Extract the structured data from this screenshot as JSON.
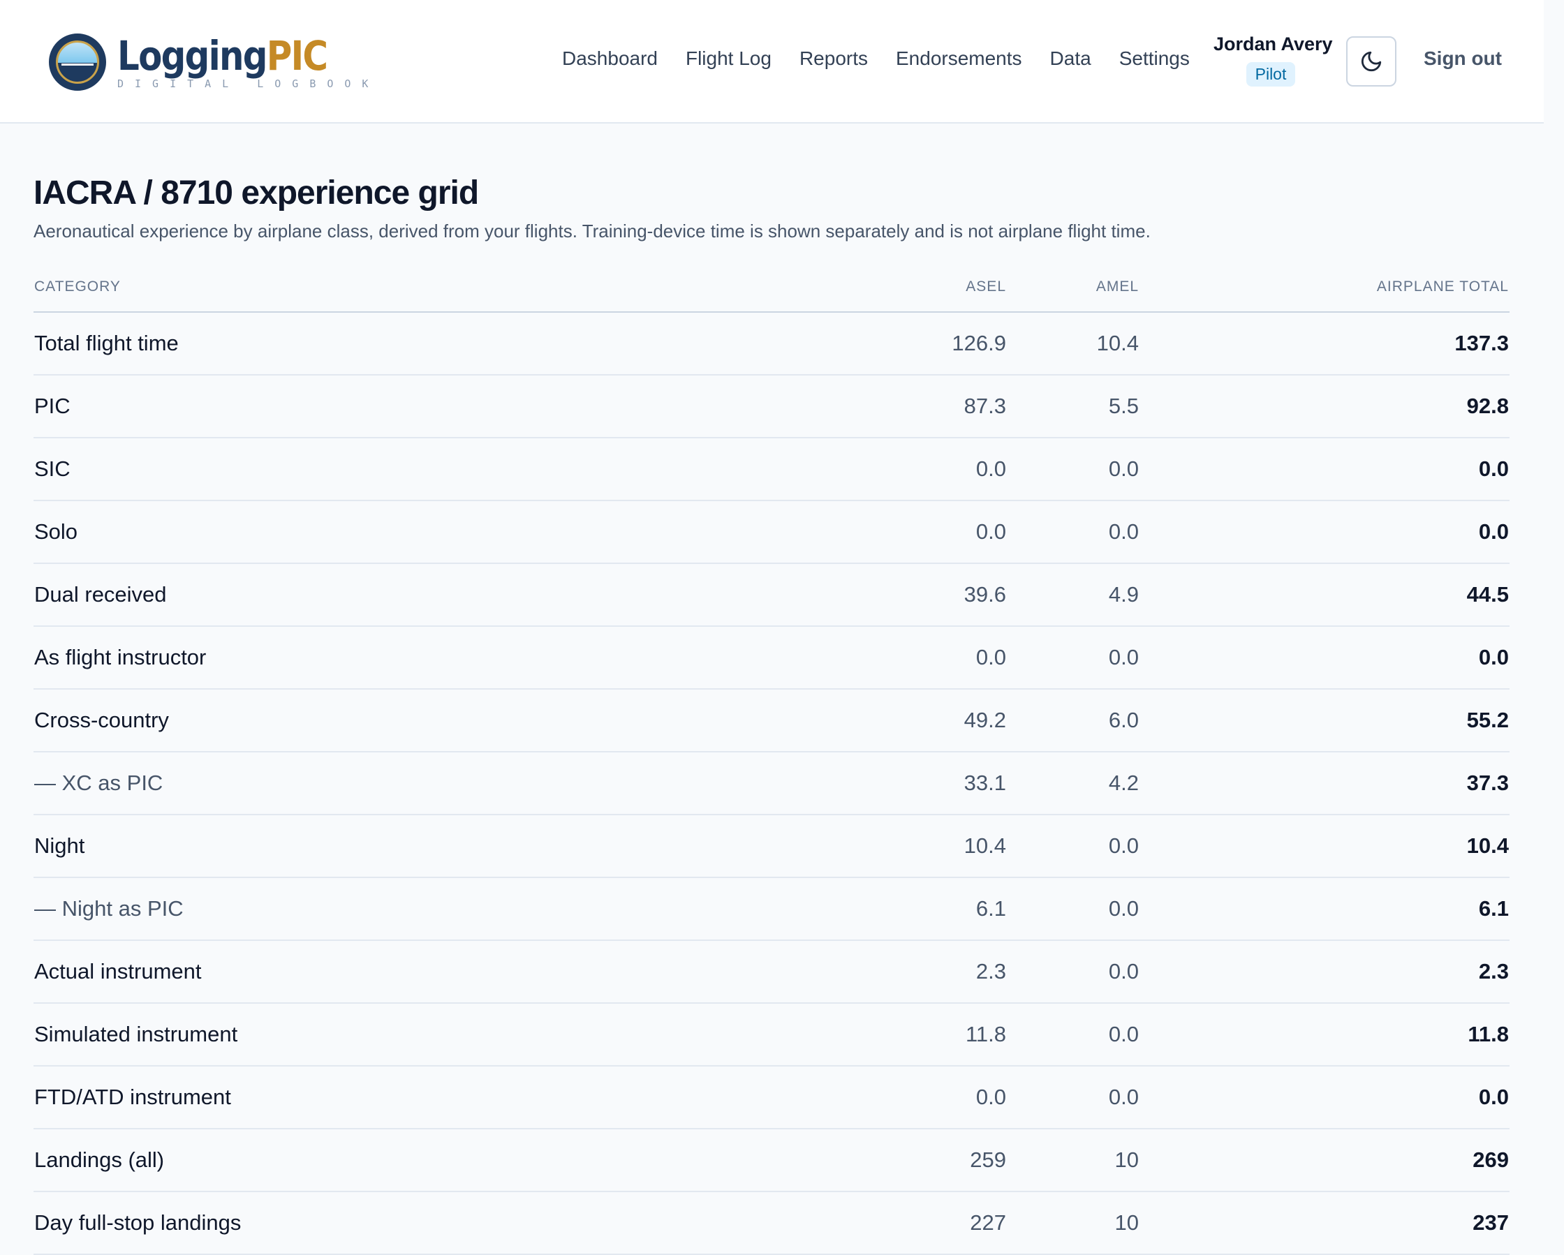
{
  "brand": {
    "word_primary": "Logging",
    "word_accent": "PIC",
    "tagline": "DIGITAL LOGBOOK"
  },
  "nav": {
    "items": [
      "Dashboard",
      "Flight Log",
      "Reports",
      "Endorsements",
      "Data",
      "Settings"
    ]
  },
  "user": {
    "name": "Jordan Avery",
    "role": "Pilot"
  },
  "header": {
    "theme_icon": "moon-icon",
    "sign_out": "Sign out"
  },
  "page": {
    "title": "IACRA / 8710 experience grid",
    "subtitle": "Aeronautical experience by airplane class, derived from your flights. Training-device time is shown separately and is not airplane flight time."
  },
  "table": {
    "columns": [
      "CATEGORY",
      "ASEL",
      "AMEL",
      "AIRPLANE TOTAL"
    ],
    "rows": [
      {
        "category": "Total flight time",
        "asel": "126.9",
        "amel": "10.4",
        "total": "137.3",
        "sub": false
      },
      {
        "category": "PIC",
        "asel": "87.3",
        "amel": "5.5",
        "total": "92.8",
        "sub": false
      },
      {
        "category": "SIC",
        "asel": "0.0",
        "amel": "0.0",
        "total": "0.0",
        "sub": false
      },
      {
        "category": "Solo",
        "asel": "0.0",
        "amel": "0.0",
        "total": "0.0",
        "sub": false
      },
      {
        "category": "Dual received",
        "asel": "39.6",
        "amel": "4.9",
        "total": "44.5",
        "sub": false
      },
      {
        "category": "As flight instructor",
        "asel": "0.0",
        "amel": "0.0",
        "total": "0.0",
        "sub": false
      },
      {
        "category": "Cross-country",
        "asel": "49.2",
        "amel": "6.0",
        "total": "55.2",
        "sub": false
      },
      {
        "category": "— XC as PIC",
        "asel": "33.1",
        "amel": "4.2",
        "total": "37.3",
        "sub": true
      },
      {
        "category": "Night",
        "asel": "10.4",
        "amel": "0.0",
        "total": "10.4",
        "sub": false
      },
      {
        "category": "— Night as PIC",
        "asel": "6.1",
        "amel": "0.0",
        "total": "6.1",
        "sub": true
      },
      {
        "category": "Actual instrument",
        "asel": "2.3",
        "amel": "0.0",
        "total": "2.3",
        "sub": false
      },
      {
        "category": "Simulated instrument",
        "asel": "11.8",
        "amel": "0.0",
        "total": "11.8",
        "sub": false
      },
      {
        "category": "FTD/ATD instrument",
        "asel": "0.0",
        "amel": "0.0",
        "total": "0.0",
        "sub": false
      },
      {
        "category": "Landings (all)",
        "asel": "259",
        "amel": "10",
        "total": "269",
        "sub": false
      },
      {
        "category": "Day full-stop landings",
        "asel": "227",
        "amel": "10",
        "total": "237",
        "sub": false
      }
    ]
  },
  "colors": {
    "brand_navy": "#1e3a5f",
    "brand_gold": "#c58a26",
    "badge_bg": "#e0f2fe",
    "badge_text": "#0369a1"
  }
}
